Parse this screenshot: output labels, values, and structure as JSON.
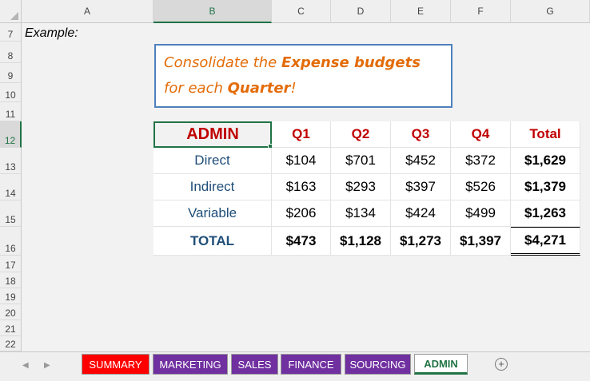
{
  "columns": [
    "A",
    "B",
    "C",
    "D",
    "E",
    "F",
    "G"
  ],
  "rows": [
    "7",
    "8",
    "9",
    "10",
    "11",
    "12",
    "13",
    "14",
    "15",
    "16",
    "17",
    "18",
    "19",
    "20",
    "21",
    "22"
  ],
  "example_label": "Example:",
  "note": {
    "part1": "Consolidate the ",
    "bold1": "Expense budgets",
    "part2": " for each ",
    "bold2": "Quarter",
    "part3": "!"
  },
  "table": {
    "corner": "ADMIN",
    "headers": [
      "Q1",
      "Q2",
      "Q3",
      "Q4",
      "Total"
    ],
    "rows": [
      {
        "label": "Direct",
        "values": [
          "$104",
          "$701",
          "$452",
          "$372",
          "$1,629"
        ]
      },
      {
        "label": "Indirect",
        "values": [
          "$163",
          "$293",
          "$397",
          "$526",
          "$1,379"
        ]
      },
      {
        "label": "Variable",
        "values": [
          "$206",
          "$134",
          "$424",
          "$499",
          "$1,263"
        ]
      },
      {
        "label": "TOTAL",
        "values": [
          "$473",
          "$1,128",
          "$1,273",
          "$1,397",
          "$4,271"
        ]
      }
    ]
  },
  "tabs": [
    {
      "label": "SUMMARY",
      "color": "#ff0000"
    },
    {
      "label": "MARKETING",
      "color": "#7030a0"
    },
    {
      "label": "SALES",
      "color": "#7030a0"
    },
    {
      "label": "FINANCE",
      "color": "#7030a0"
    },
    {
      "label": "SOURCING",
      "color": "#7030a0"
    },
    {
      "label": "ADMIN",
      "color": "#ffffff",
      "active": true
    }
  ],
  "nav_icons": [
    "scroll-left-icon",
    "scroll-right-icon"
  ],
  "add_sheet_icon": "plus-icon"
}
